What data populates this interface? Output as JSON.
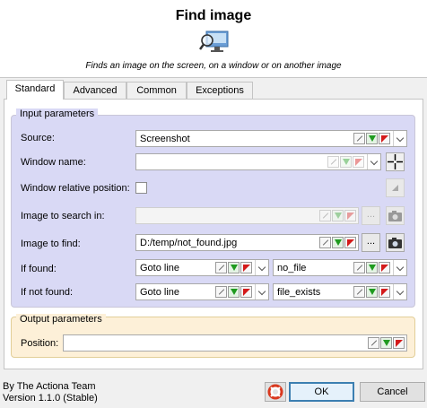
{
  "dialog": {
    "title": "Find image",
    "icon": "find-image-icon",
    "description": "Finds an image on the screen, on a window or on another image"
  },
  "tabs": [
    {
      "label": "Standard",
      "active": true
    },
    {
      "label": "Advanced",
      "active": false
    },
    {
      "label": "Common",
      "active": false
    },
    {
      "label": "Exceptions",
      "active": false
    }
  ],
  "input_parameters": {
    "title": "Input parameters",
    "source": {
      "label": "Source:",
      "value": "Screenshot"
    },
    "window_name": {
      "label": "Window name:",
      "value": ""
    },
    "window_relative_position": {
      "label": "Window relative position:",
      "checked": false
    },
    "image_to_search_in": {
      "label": "Image to search in:",
      "value": "",
      "browse": "..."
    },
    "image_to_find": {
      "label": "Image to find:",
      "value": "D:/temp/not_found.jpg",
      "browse": "..."
    },
    "if_found": {
      "label": "If found:",
      "action": "Goto line",
      "target": "no_file"
    },
    "if_not_found": {
      "label": "If not found:",
      "action": "Goto line",
      "target": "file_exists"
    }
  },
  "output_parameters": {
    "title": "Output parameters",
    "position": {
      "label": "Position:",
      "value": ""
    }
  },
  "footer": {
    "author": "By The Actiona Team",
    "version": "Version 1.1.0 (Stable)",
    "ok": "OK",
    "cancel": "Cancel"
  },
  "colors": {
    "input_group_bg": "#d9d9f5",
    "output_group_bg": "#fdf0d8",
    "primary_button_border": "#3c7fb1",
    "variable_green": "#1f9a1f",
    "code_red": "#d41a1a"
  }
}
